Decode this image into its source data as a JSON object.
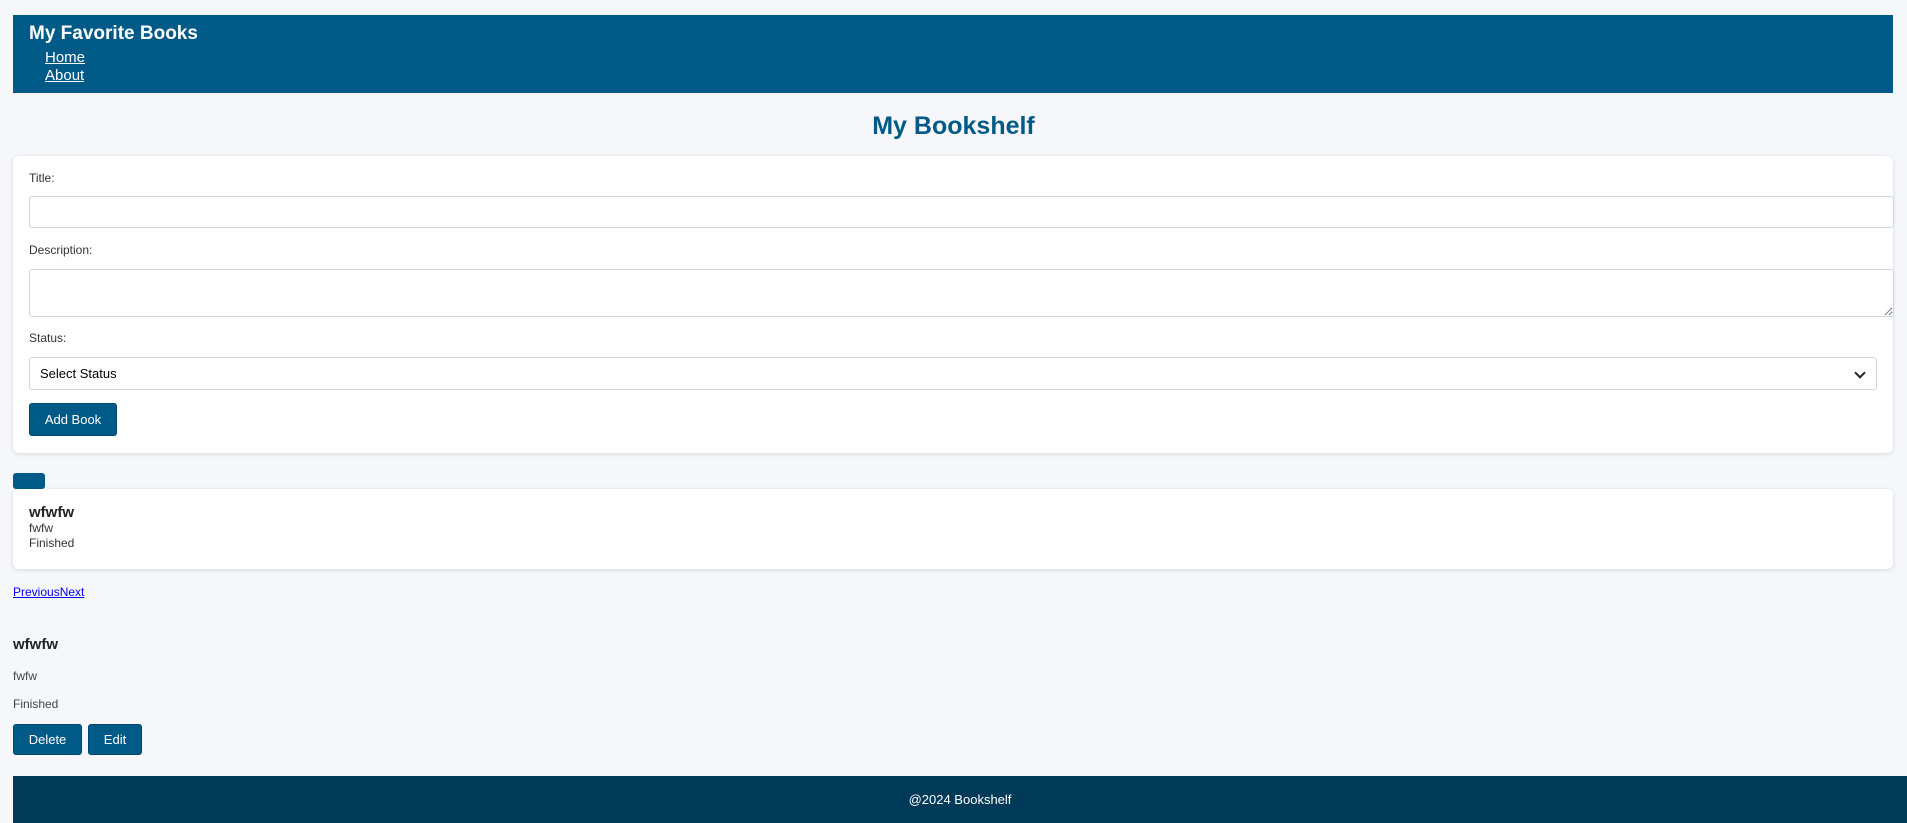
{
  "header": {
    "brand": "My Favorite Books",
    "nav": [
      "Home",
      "About"
    ]
  },
  "page": {
    "title": "My Bookshelf"
  },
  "form": {
    "title_label": "Title:",
    "title_value": "",
    "description_label": "Description:",
    "description_value": "",
    "status_label": "Status:",
    "status_selected": "Select Status",
    "add_button": "Add Book"
  },
  "books": [
    {
      "title": "wfwfw",
      "description": "fwfw",
      "status": "Finished"
    }
  ],
  "pagination": {
    "previous": "Previous",
    "next": "Next"
  },
  "detail": {
    "title": "wfwfw",
    "description": "fwfw",
    "status": "Finished",
    "delete_button": "Delete",
    "edit_button": "Edit"
  },
  "footer": {
    "text": "@2024 Bookshelf"
  },
  "colors": {
    "primary": "#005a87",
    "footer": "#003a59",
    "background": "#f6f7fb"
  }
}
